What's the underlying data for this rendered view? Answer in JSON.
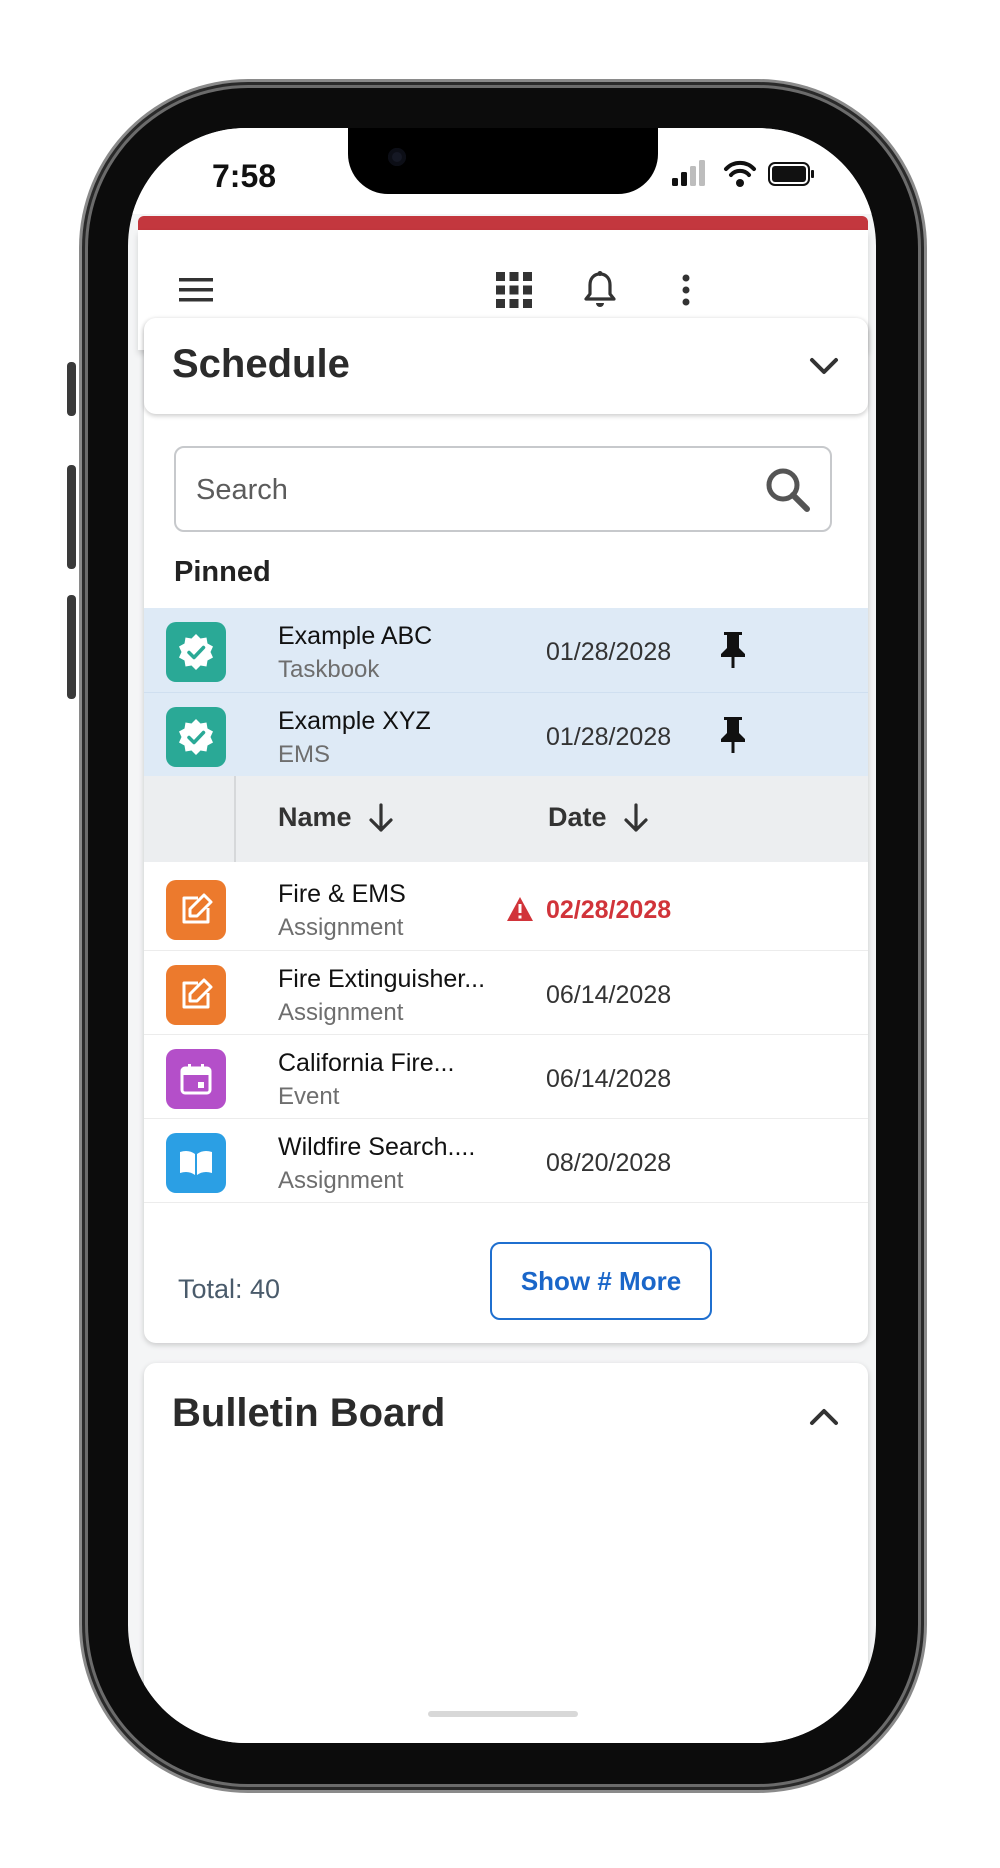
{
  "status_bar": {
    "time": "7:58"
  },
  "schedule": {
    "title": "Schedule",
    "search_placeholder": "Search",
    "pinned_label": "Pinned",
    "pinned_items": [
      {
        "name": "Example ABC",
        "type": "Taskbook",
        "date": "01/28/2028",
        "icon": "badge-check-icon",
        "color": "#2aa996"
      },
      {
        "name": "Example XYZ",
        "type": "EMS",
        "date": "01/28/2028",
        "icon": "badge-check-icon",
        "color": "#2aa996"
      }
    ],
    "columns": {
      "name": "Name",
      "date": "Date"
    },
    "items": [
      {
        "name": "Fire & EMS",
        "type": "Assignment",
        "date": "02/28/2028",
        "overdue": true,
        "icon": "edit-icon",
        "color": "#ec7a2d"
      },
      {
        "name": "Fire Extinguisher...",
        "type": "Assignment",
        "date": "06/14/2028",
        "icon": "edit-icon",
        "color": "#ec7a2d"
      },
      {
        "name": "California Fire...",
        "type": "Event",
        "date": "06/14/2028",
        "icon": "calendar-icon",
        "color": "#b44fc9"
      },
      {
        "name": "Wildfire Search....",
        "type": "Assignment",
        "date": "08/20/2028",
        "icon": "book-icon",
        "color": "#2b9fe4"
      }
    ],
    "total_label": "Total: 40",
    "show_more_label": "Show # More"
  },
  "bulletin": {
    "title": "Bulletin Board"
  },
  "colors": {
    "brand_red": "#c3373e",
    "link_blue": "#1a66c9",
    "overdue_red": "#d1343a",
    "pinned_bg": "#deeaf6"
  }
}
